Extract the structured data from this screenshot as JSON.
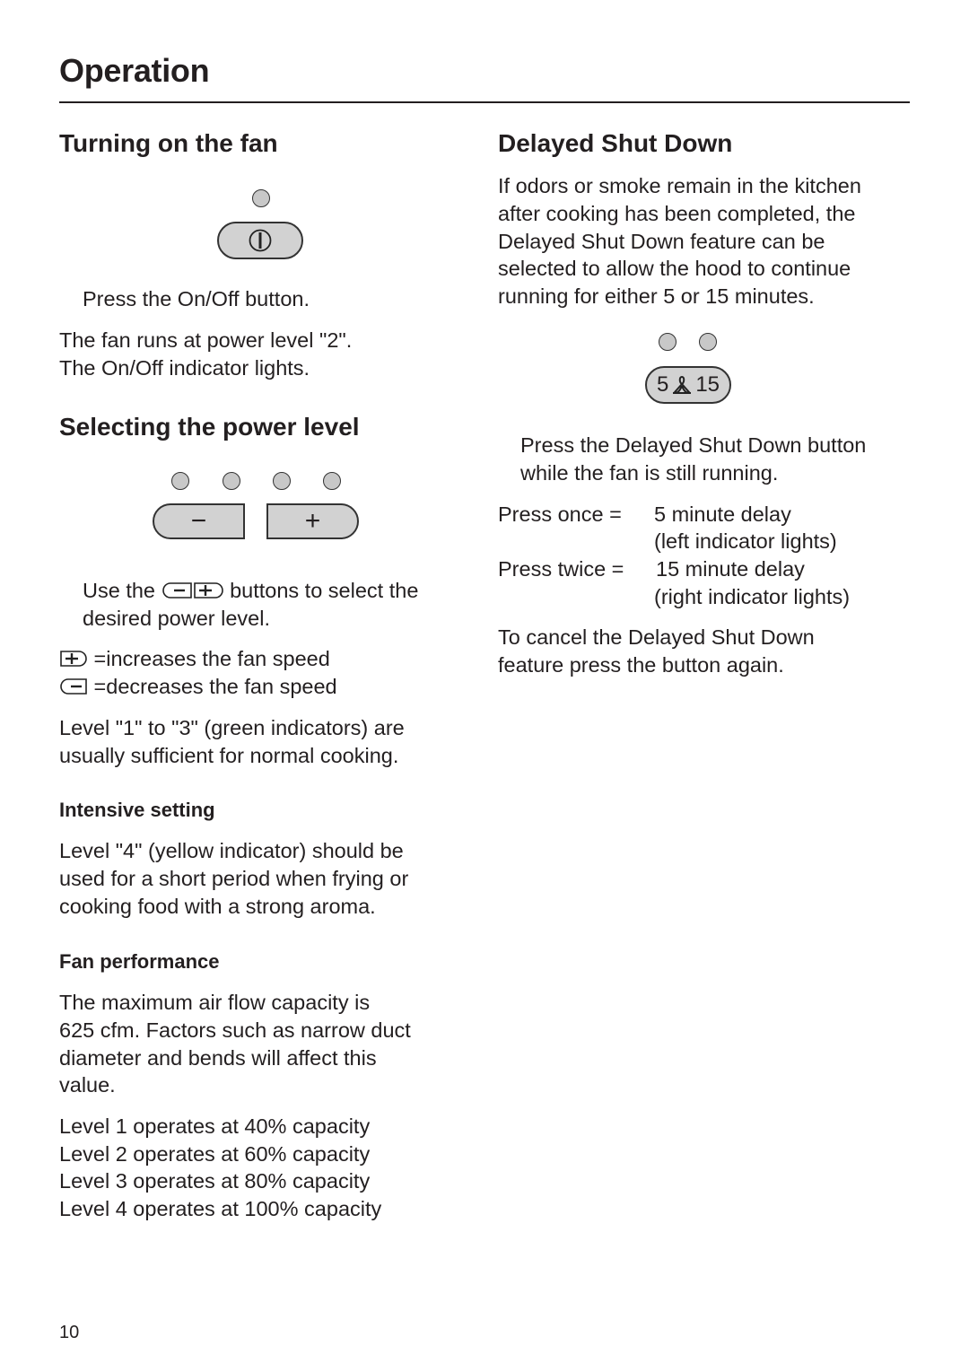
{
  "page": {
    "title": "Operation",
    "page_number": "10"
  },
  "turning_on": {
    "heading": "Turning on the fan",
    "instruction": "Press the On/Off button.",
    "result_lines": [
      "The fan runs at power level \"2\".",
      "The On/Off indicator lights."
    ]
  },
  "power_level": {
    "heading": "Selecting the power level",
    "instruction_pre": "Use the",
    "instruction_post": "buttons to select the",
    "instruction_line2": "desired power level.",
    "plus_desc": "=increases the fan speed",
    "minus_desc": "=decreases the fan speed",
    "minus_label": "−",
    "plus_label": "+",
    "note_lines": [
      "Level \"1\" to \"3\" (green indicators) are",
      "usually sufficient for normal cooking."
    ]
  },
  "intensive": {
    "heading": "Intensive setting",
    "lines": [
      "Level \"4\" (yellow indicator) should be",
      "used for a short period when frying or",
      "cooking food with a strong aroma."
    ]
  },
  "fan_performance": {
    "heading": "Fan performance",
    "lines": [
      "The maximum air flow capacity is",
      "625 cfm. Factors such as narrow duct",
      "diameter and bends will affect this",
      "value."
    ],
    "levels": [
      "Level 1 operates at 40% capacity",
      "Level 2 operates at 60% capacity",
      "Level 3 operates at 80% capacity",
      "Level 4 operates at 100% capacity"
    ]
  },
  "delayed": {
    "heading": "Delayed Shut Down",
    "intro_lines": [
      "If odors or smoke remain in the kitchen",
      "after cooking has been completed, the",
      "Delayed Shut Down feature can be",
      "selected to allow the hood to continue",
      "running for either 5 or 15 minutes."
    ],
    "button_left": "5",
    "button_right": "15",
    "instruction_lines": [
      "Press the Delayed Shut Down button",
      "while the fan is still running."
    ],
    "once_label": "Press once =",
    "once_value": "5 minute delay",
    "once_note": "(left indicator lights)",
    "twice_label": "Press twice =",
    "twice_value": "15 minute delay",
    "twice_note": "(right indicator lights)",
    "cancel_lines": [
      "To cancel the Delayed Shut Down",
      "feature press the button again."
    ]
  }
}
